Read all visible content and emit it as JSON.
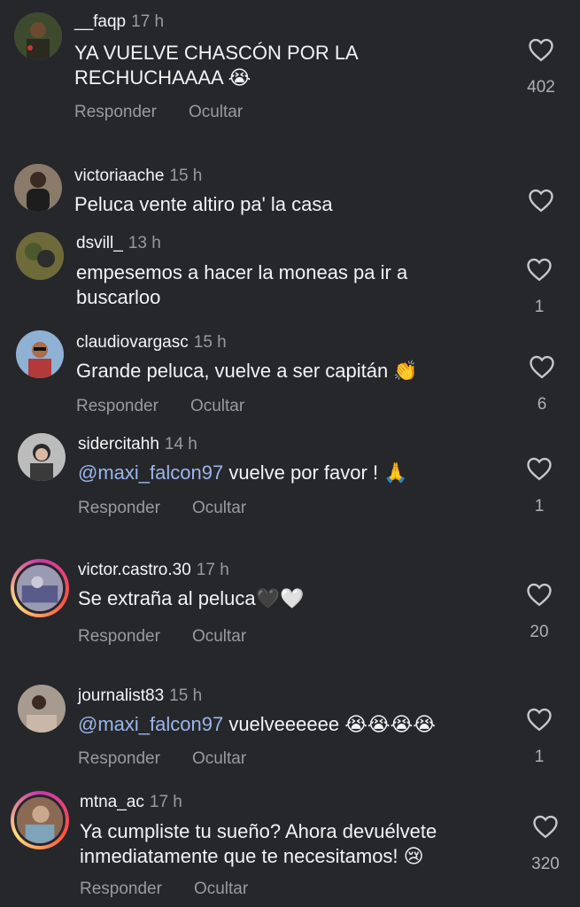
{
  "comments": [
    {
      "user": "__faqp",
      "time": "17 h",
      "text": "YA VUELVE CHASCÓN POR LA RECHUCHAAAA 😭",
      "reply": "Responder",
      "hide": "Ocultar",
      "likes": "402"
    },
    {
      "user": "victoriaache",
      "time": "15 h",
      "text": "Peluca vente altiro pa' la casa",
      "likes": ""
    },
    {
      "user": "dsvill_",
      "time": "13 h",
      "text": "empesemos a hacer la moneas pa ir a buscarloo",
      "likes": "1"
    },
    {
      "user": "claudiovargasc",
      "time": "15 h",
      "text": "Grande peluca, vuelve a ser capitán 👏",
      "reply": "Responder",
      "hide": "Ocultar",
      "likes": "6"
    },
    {
      "user": "sidercitahh",
      "time": "14 h",
      "mention": "@maxi_falcon97",
      "text": " vuelve por favor ! 🙏",
      "reply": "Responder",
      "hide": "Ocultar",
      "likes": "1"
    },
    {
      "user": "victor.castro.30",
      "time": "17 h",
      "text": "Se extraña al peluca🖤🤍",
      "reply": "Responder",
      "hide": "Ocultar",
      "likes": "20"
    },
    {
      "user": "journalist83",
      "time": "15 h",
      "mention": "@maxi_falcon97",
      "text": " vuelveeeeee 😭😭😭😭",
      "reply": "Responder",
      "hide": "Ocultar",
      "likes": "1"
    },
    {
      "user": "mtna_ac",
      "time": "17 h",
      "text": "Ya cumpliste tu sueño? Ahora devuélvete inmediatamente que te necesitamos! 😢",
      "reply": "Responder",
      "hide": "Ocultar",
      "likes": "320"
    }
  ],
  "icons": {
    "like": "heart-outline-icon"
  },
  "colors": {
    "background": "#26272b",
    "mention": "#9bb6ea",
    "muted": "#9a9a9e"
  }
}
